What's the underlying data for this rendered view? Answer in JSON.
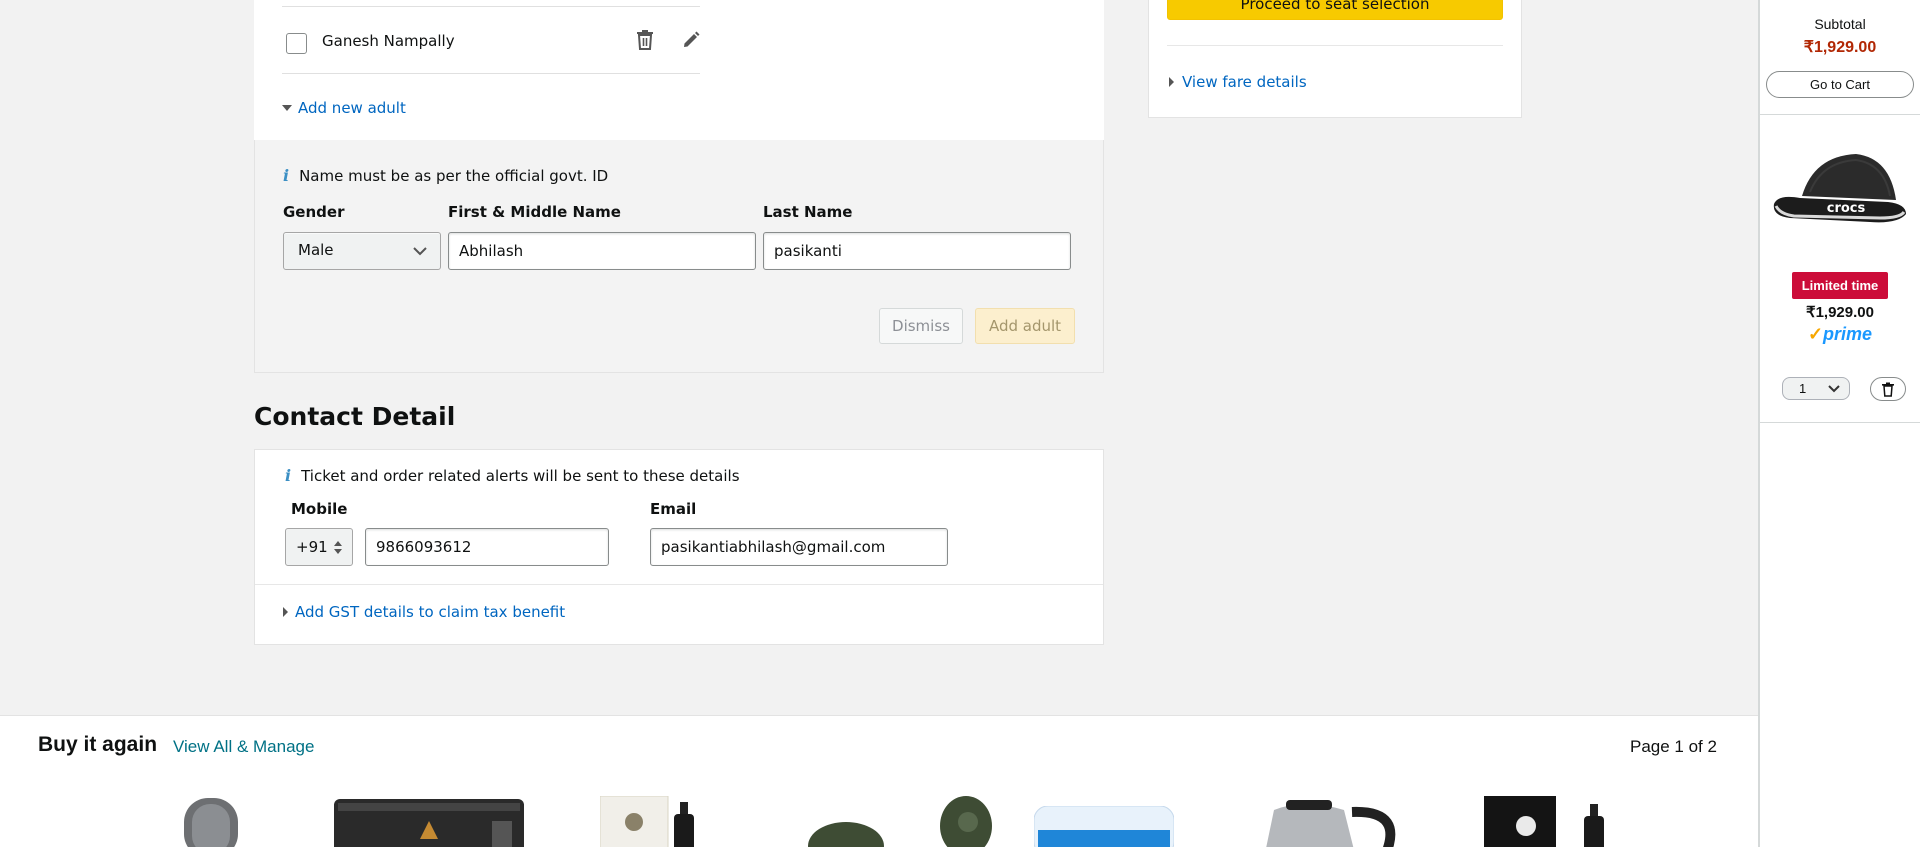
{
  "passenger": {
    "saved_name": "Ganesh Nampally",
    "add_new_adult_label": "Add new adult"
  },
  "add_adult_form": {
    "info_text": "Name must be as per the official govt. ID",
    "gender_label": "Gender",
    "gender_value": "Male",
    "first_name_label": "First & Middle Name",
    "first_name_value": "Abhilash",
    "last_name_label": "Last Name",
    "last_name_value": "pasikanti",
    "dismiss_label": "Dismiss",
    "add_adult_label": "Add adult"
  },
  "contact": {
    "heading": "Contact Detail",
    "info_text": "Ticket and order related alerts will be sent to these details",
    "mobile_label": "Mobile",
    "country_code": "+91",
    "mobile_value": "9866093612",
    "email_label": "Email",
    "email_value": "pasikantiabhilash@gmail.com",
    "gst_link": "Add GST details to claim tax benefit"
  },
  "summary": {
    "proceed_label": "Proceed to seat selection",
    "fare_details_label": "View fare details"
  },
  "buy_again": {
    "title": "Buy it again",
    "manage_link": "View All & Manage",
    "page_indicator": "Page 1 of 2"
  },
  "cart": {
    "subtotal_label": "Subtotal",
    "subtotal_amount": "₹1,929.00",
    "go_to_cart_label": "Go to Cart",
    "item_logo_text": "crocs",
    "deal_badge": "Limited time",
    "item_price": "₹1,929.00",
    "prime_label": "prime",
    "quantity": "1"
  },
  "colors": {
    "link": "#0066c0",
    "price_red": "#b12704",
    "deal_red": "#cc0c39",
    "primary_button": "#f7ca00",
    "prime_blue": "#1a98ff"
  }
}
